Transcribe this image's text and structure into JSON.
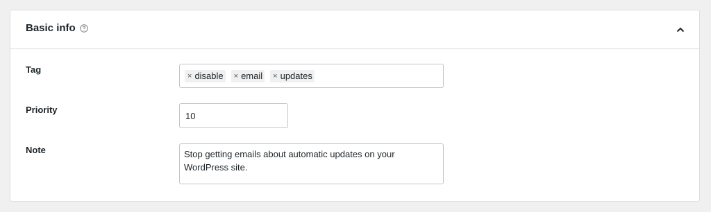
{
  "panel": {
    "title": "Basic info",
    "help_icon": "question-circle-icon",
    "toggle_icon": "chevron-up-icon"
  },
  "fields": {
    "tag": {
      "label": "Tag",
      "chips": [
        "disable",
        "email",
        "updates"
      ],
      "remove_glyph": "×"
    },
    "priority": {
      "label": "Priority",
      "value": "10"
    },
    "note": {
      "label": "Note",
      "value": "Stop getting emails about automatic updates on your WordPress site."
    }
  },
  "colors": {
    "background": "#f0f0f1",
    "panel": "#ffffff",
    "border": "#dcdcde",
    "input_border": "#c3c4c7",
    "text": "#1d2327"
  }
}
